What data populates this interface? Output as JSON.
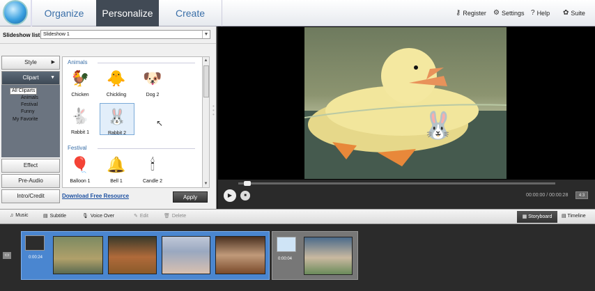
{
  "tabs": {
    "organize": "Organize",
    "personalize": "Personalize",
    "create": "Create"
  },
  "toplinks": {
    "register": "Register",
    "settings": "Settings",
    "help": "Help",
    "suite": "Suite"
  },
  "slideshow": {
    "label": "Slideshow list :",
    "value": "Slideshow 1"
  },
  "sidebar": {
    "style": "Style",
    "clipart": "Clipart",
    "effect": "Effect",
    "preaudio": "Pre-Audio",
    "intro": "Intro/Credit"
  },
  "tree": {
    "all": "All Cliparts",
    "animals": "Animals",
    "festival": "Festival",
    "funny": "Funny",
    "favorite": "My Favorite"
  },
  "gallery": {
    "cat_animals": "Animals",
    "cat_festival": "Festival",
    "items": [
      {
        "label": "Chicken",
        "icon": "🐓"
      },
      {
        "label": "Chickling",
        "icon": "🐥"
      },
      {
        "label": "Dog 2",
        "icon": "🐶"
      },
      {
        "label": "Rabbit 1",
        "icon": "🐇"
      },
      {
        "label": "Rabbit 2",
        "icon": "🐰"
      },
      {
        "label": "Balloon 1",
        "icon": "🎈"
      },
      {
        "label": "Bell 1",
        "icon": "🔔"
      },
      {
        "label": "Candle 2",
        "icon": "🕯"
      }
    ]
  },
  "download": "Download Free Resource",
  "apply": "Apply",
  "player": {
    "timecode": "00:00:00 / 00:00:28",
    "ratio": "4:3"
  },
  "toolbar": {
    "music": "Music",
    "subtitle": "Subtitle",
    "voiceover": "Voice Over",
    "edit": "Edit",
    "delete": "Delete",
    "storyboard": "Storyboard",
    "timeline": "Timeline"
  },
  "story": {
    "group1_time": "0:00:24",
    "group2_time": "0:00:04"
  }
}
